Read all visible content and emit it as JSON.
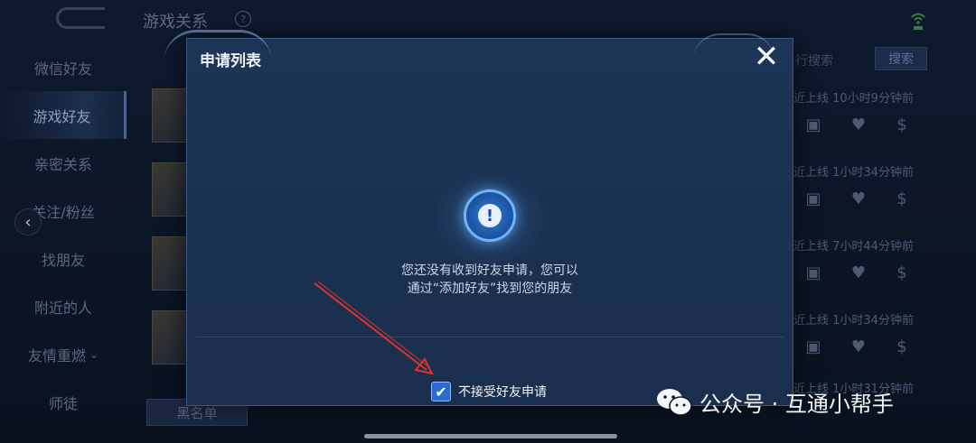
{
  "header": {
    "title": "游戏关系",
    "help": "?"
  },
  "sidebar": {
    "items": [
      {
        "label": "微信好友"
      },
      {
        "label": "游戏好友"
      },
      {
        "label": "亲密关系"
      },
      {
        "label": "关注/粉丝"
      },
      {
        "label": "找朋友"
      },
      {
        "label": "附近的人"
      },
      {
        "label": "友情重燃"
      },
      {
        "label": "师徒"
      }
    ],
    "blacklist_label": "黑名单"
  },
  "friends_list": {
    "search_hint": "行搜索",
    "search_label": "搜索",
    "rows": [
      {
        "status": "近上线  10小时9分钟前"
      },
      {
        "status": "近上线  1小时34分钟前"
      },
      {
        "status": "近上线  7小时44分钟前"
      },
      {
        "status": "近上线  1小时34分钟前"
      },
      {
        "status": "近上线  1小时31分钟前"
      }
    ]
  },
  "modal": {
    "title": "申请列表",
    "close_glyph": "✕",
    "empty_icon_glyph": "!",
    "empty_line1": "您还没有收到好友申请，您可以",
    "empty_line2": "通过“添加好友”找到您的朋友",
    "checkbox_checked": true,
    "checkbox_glyph": "✔",
    "checkbox_label": "不接受好友申请"
  },
  "watermark": {
    "text": "公众号 · 互通小帮手"
  },
  "colors": {
    "accent": "#2a6bd1",
    "arrow": "#e0322c",
    "modal_bg": "#1d3456"
  }
}
